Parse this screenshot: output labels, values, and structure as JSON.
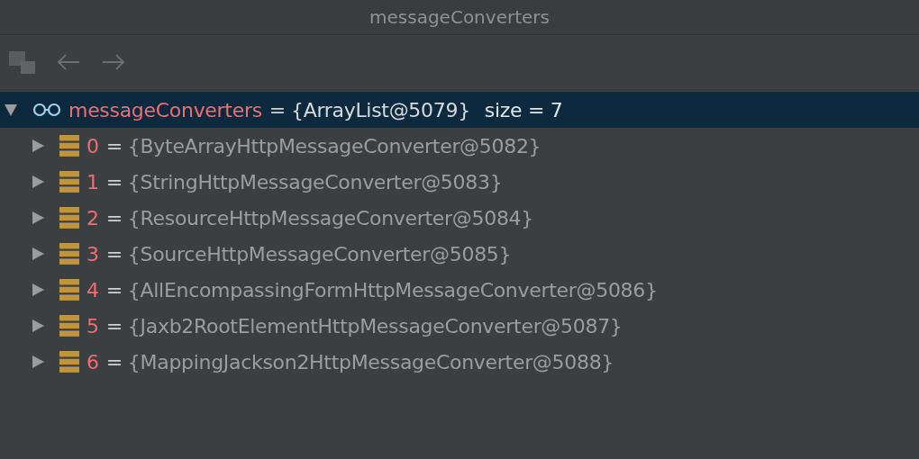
{
  "window": {
    "title": "messageConverters"
  },
  "tree": [
    {
      "name": "messageConverters",
      "sep": "=",
      "value": "{ArrayList@5079}",
      "extra": "size = 7",
      "kind": "watch",
      "expanded": true,
      "selected": true,
      "children": [
        {
          "name": "0",
          "sep": "=",
          "value": "{ByteArrayHttpMessageConverter@5082}",
          "kind": "field",
          "expanded": false,
          "selected": false
        },
        {
          "name": "1",
          "sep": "=",
          "value": "{StringHttpMessageConverter@5083}",
          "kind": "field",
          "expanded": false,
          "selected": false
        },
        {
          "name": "2",
          "sep": "=",
          "value": "{ResourceHttpMessageConverter@5084}",
          "kind": "field",
          "expanded": false,
          "selected": false
        },
        {
          "name": "3",
          "sep": "=",
          "value": "{SourceHttpMessageConverter@5085}",
          "kind": "field",
          "expanded": false,
          "selected": false
        },
        {
          "name": "4",
          "sep": "=",
          "value": "{AllEncompassingFormHttpMessageConverter@5086}",
          "kind": "field",
          "expanded": false,
          "selected": false
        },
        {
          "name": "5",
          "sep": "=",
          "value": "{Jaxb2RootElementHttpMessageConverter@5087}",
          "kind": "field",
          "expanded": false,
          "selected": false
        },
        {
          "name": "6",
          "sep": "=",
          "value": "{MappingJackson2HttpMessageConverter@5088}",
          "kind": "field",
          "expanded": false,
          "selected": false
        }
      ]
    }
  ]
}
